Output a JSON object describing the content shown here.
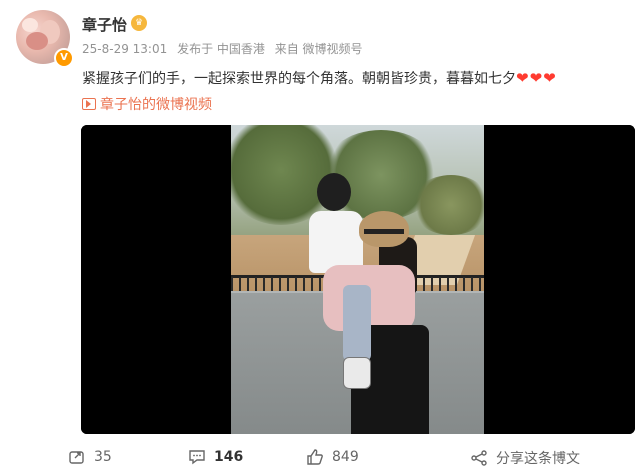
{
  "author": {
    "name": "章子怡",
    "verified_badge": "V",
    "crown_glyph": "♛"
  },
  "meta": {
    "time": "25-8-29 13:01",
    "location": "发布于 中国香港",
    "source": "来自 微博视频号"
  },
  "post": {
    "text": "紧握孩子们的手，一起探索世界的每个角落。朝朝皆珍贵，暮暮如七夕",
    "hearts": "❤❤❤",
    "video_link_label": "章子怡的微博视频"
  },
  "video": {
    "icon": "video-icon"
  },
  "actions": {
    "forward_count": "35",
    "comment_count": "146",
    "like_count": "849",
    "share_label": "分享这条博文"
  },
  "colors": {
    "link": "#eb7350",
    "meta": "#939393",
    "text": "#333333",
    "heart": "#ff3b30",
    "verified": "#ff9a00"
  }
}
